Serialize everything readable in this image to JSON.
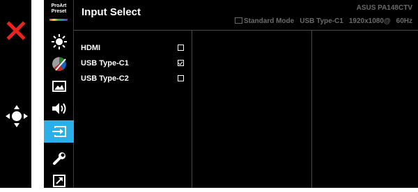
{
  "remote": {
    "close_icon": "close-icon",
    "dpad_icon": "dpad-icon"
  },
  "logo": {
    "line1": "ProArt",
    "line2": "Preset"
  },
  "sidebar": {
    "items": [
      {
        "icon": "brightness-icon"
      },
      {
        "icon": "color-icon"
      },
      {
        "icon": "image-icon"
      },
      {
        "icon": "sound-icon"
      },
      {
        "icon": "input-select-icon",
        "active": true
      },
      {
        "icon": "system-setup-icon"
      },
      {
        "icon": "shortcut-icon"
      }
    ],
    "active_color": "#29b0e8"
  },
  "header": {
    "title": "Input Select",
    "model": "ASUS PA148CTV",
    "mode": "Standard Mode",
    "input": "USB Type-C1",
    "resolution": "1920x1080@",
    "refresh": "60Hz"
  },
  "options": [
    {
      "label": "HDMI",
      "checked": false
    },
    {
      "label": "USB Type-C1",
      "checked": true
    },
    {
      "label": "USB Type-C2",
      "checked": false
    }
  ]
}
